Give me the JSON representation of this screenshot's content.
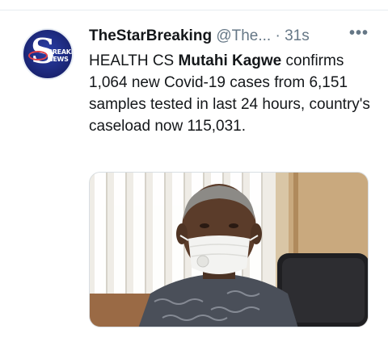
{
  "tweet": {
    "display_name": "TheStarBreaking",
    "handle": "@The...",
    "separator": "·",
    "time": "31s",
    "more_label": "•••",
    "avatar": {
      "letter": "S",
      "text_line1": "BREAKING",
      "text_line2": "NEWS"
    },
    "text_intro": "HEALTH CS ",
    "text_bold": "Mutahi Kagwe",
    "text_rest": " confirms 1,064 new Covid-19 cases from 6,151 samples tested in last 24 hours, country's caseload now 115,031."
  },
  "colors": {
    "name": "#14171a",
    "meta": "#657786",
    "avatar_bg": "#1a2472",
    "avatar_accent": "#e0404a"
  }
}
